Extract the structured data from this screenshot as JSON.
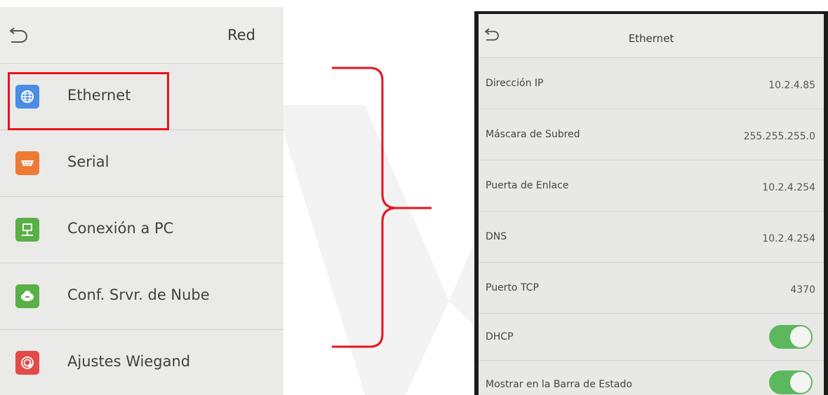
{
  "left_screen": {
    "title": "Red",
    "back_icon": "back-arrow-icon",
    "items": [
      {
        "label": "Ethernet",
        "icon": "globe-icon",
        "icon_color": "#4a8de4"
      },
      {
        "label": "Serial",
        "icon": "serial-port-icon",
        "icon_color": "#ee7a35"
      },
      {
        "label": "Conexión a PC",
        "icon": "pc-connection-icon",
        "icon_color": "#59b046"
      },
      {
        "label": "Conf. Srvr. de Nube",
        "icon": "cloud-icon",
        "icon_color": "#59b046"
      },
      {
        "label": "Ajustes Wiegand",
        "icon": "wiegand-icon",
        "icon_color": "#e24a4a"
      }
    ],
    "highlight_color": "#e8131c"
  },
  "right_screen": {
    "title": "Ethernet",
    "back_icon": "back-arrow-icon",
    "rows": [
      {
        "label": "Dirección IP",
        "value": "10.2.4.85"
      },
      {
        "label": "Máscara de Subred",
        "value": "255.255.255.0"
      },
      {
        "label": "Puerta de Enlace",
        "value": "10.2.4.254"
      },
      {
        "label": "DNS",
        "value": "10.2.4.254"
      },
      {
        "label": "Puerto TCP",
        "value": "4370"
      }
    ],
    "toggles": [
      {
        "label": "DHCP",
        "on": true
      },
      {
        "label": "Mostrar en la Barra de Estado",
        "on": true
      }
    ],
    "toggle_color": "#5cb85c"
  }
}
